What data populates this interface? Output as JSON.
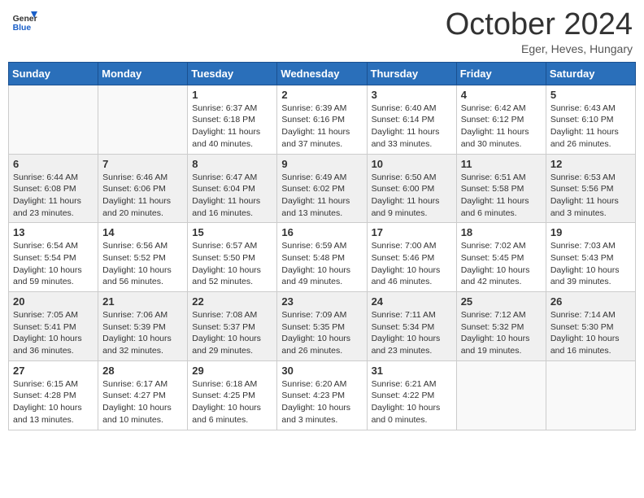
{
  "header": {
    "logo_general": "General",
    "logo_blue": "Blue",
    "month_title": "October 2024",
    "subtitle": "Eger, Heves, Hungary"
  },
  "days_of_week": [
    "Sunday",
    "Monday",
    "Tuesday",
    "Wednesday",
    "Thursday",
    "Friday",
    "Saturday"
  ],
  "weeks": [
    [
      {
        "day": "",
        "info": ""
      },
      {
        "day": "",
        "info": ""
      },
      {
        "day": "1",
        "info": "Sunrise: 6:37 AM\nSunset: 6:18 PM\nDaylight: 11 hours and 40 minutes."
      },
      {
        "day": "2",
        "info": "Sunrise: 6:39 AM\nSunset: 6:16 PM\nDaylight: 11 hours and 37 minutes."
      },
      {
        "day": "3",
        "info": "Sunrise: 6:40 AM\nSunset: 6:14 PM\nDaylight: 11 hours and 33 minutes."
      },
      {
        "day": "4",
        "info": "Sunrise: 6:42 AM\nSunset: 6:12 PM\nDaylight: 11 hours and 30 minutes."
      },
      {
        "day": "5",
        "info": "Sunrise: 6:43 AM\nSunset: 6:10 PM\nDaylight: 11 hours and 26 minutes."
      }
    ],
    [
      {
        "day": "6",
        "info": "Sunrise: 6:44 AM\nSunset: 6:08 PM\nDaylight: 11 hours and 23 minutes."
      },
      {
        "day": "7",
        "info": "Sunrise: 6:46 AM\nSunset: 6:06 PM\nDaylight: 11 hours and 20 minutes."
      },
      {
        "day": "8",
        "info": "Sunrise: 6:47 AM\nSunset: 6:04 PM\nDaylight: 11 hours and 16 minutes."
      },
      {
        "day": "9",
        "info": "Sunrise: 6:49 AM\nSunset: 6:02 PM\nDaylight: 11 hours and 13 minutes."
      },
      {
        "day": "10",
        "info": "Sunrise: 6:50 AM\nSunset: 6:00 PM\nDaylight: 11 hours and 9 minutes."
      },
      {
        "day": "11",
        "info": "Sunrise: 6:51 AM\nSunset: 5:58 PM\nDaylight: 11 hours and 6 minutes."
      },
      {
        "day": "12",
        "info": "Sunrise: 6:53 AM\nSunset: 5:56 PM\nDaylight: 11 hours and 3 minutes."
      }
    ],
    [
      {
        "day": "13",
        "info": "Sunrise: 6:54 AM\nSunset: 5:54 PM\nDaylight: 10 hours and 59 minutes."
      },
      {
        "day": "14",
        "info": "Sunrise: 6:56 AM\nSunset: 5:52 PM\nDaylight: 10 hours and 56 minutes."
      },
      {
        "day": "15",
        "info": "Sunrise: 6:57 AM\nSunset: 5:50 PM\nDaylight: 10 hours and 52 minutes."
      },
      {
        "day": "16",
        "info": "Sunrise: 6:59 AM\nSunset: 5:48 PM\nDaylight: 10 hours and 49 minutes."
      },
      {
        "day": "17",
        "info": "Sunrise: 7:00 AM\nSunset: 5:46 PM\nDaylight: 10 hours and 46 minutes."
      },
      {
        "day": "18",
        "info": "Sunrise: 7:02 AM\nSunset: 5:45 PM\nDaylight: 10 hours and 42 minutes."
      },
      {
        "day": "19",
        "info": "Sunrise: 7:03 AM\nSunset: 5:43 PM\nDaylight: 10 hours and 39 minutes."
      }
    ],
    [
      {
        "day": "20",
        "info": "Sunrise: 7:05 AM\nSunset: 5:41 PM\nDaylight: 10 hours and 36 minutes."
      },
      {
        "day": "21",
        "info": "Sunrise: 7:06 AM\nSunset: 5:39 PM\nDaylight: 10 hours and 32 minutes."
      },
      {
        "day": "22",
        "info": "Sunrise: 7:08 AM\nSunset: 5:37 PM\nDaylight: 10 hours and 29 minutes."
      },
      {
        "day": "23",
        "info": "Sunrise: 7:09 AM\nSunset: 5:35 PM\nDaylight: 10 hours and 26 minutes."
      },
      {
        "day": "24",
        "info": "Sunrise: 7:11 AM\nSunset: 5:34 PM\nDaylight: 10 hours and 23 minutes."
      },
      {
        "day": "25",
        "info": "Sunrise: 7:12 AM\nSunset: 5:32 PM\nDaylight: 10 hours and 19 minutes."
      },
      {
        "day": "26",
        "info": "Sunrise: 7:14 AM\nSunset: 5:30 PM\nDaylight: 10 hours and 16 minutes."
      }
    ],
    [
      {
        "day": "27",
        "info": "Sunrise: 6:15 AM\nSunset: 4:28 PM\nDaylight: 10 hours and 13 minutes."
      },
      {
        "day": "28",
        "info": "Sunrise: 6:17 AM\nSunset: 4:27 PM\nDaylight: 10 hours and 10 minutes."
      },
      {
        "day": "29",
        "info": "Sunrise: 6:18 AM\nSunset: 4:25 PM\nDaylight: 10 hours and 6 minutes."
      },
      {
        "day": "30",
        "info": "Sunrise: 6:20 AM\nSunset: 4:23 PM\nDaylight: 10 hours and 3 minutes."
      },
      {
        "day": "31",
        "info": "Sunrise: 6:21 AM\nSunset: 4:22 PM\nDaylight: 10 hours and 0 minutes."
      },
      {
        "day": "",
        "info": ""
      },
      {
        "day": "",
        "info": ""
      }
    ]
  ]
}
